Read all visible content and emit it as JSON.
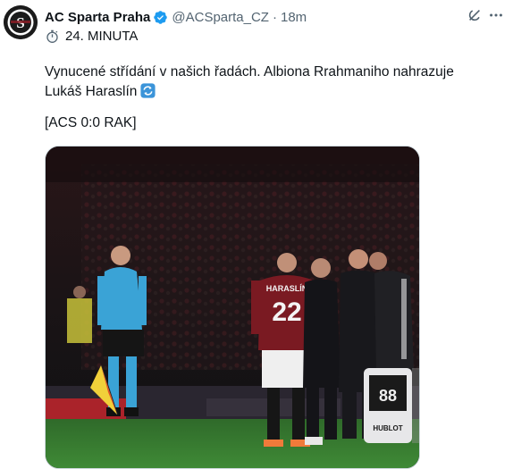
{
  "account": {
    "display_name": "AC Sparta Praha",
    "handle": "@ACSparta_CZ",
    "time_ago": "18m",
    "separator": "·"
  },
  "header_minute": "24. MINUTA",
  "tweet": {
    "text": "Vynucené střídání v našich řadách. Albiona Rrahmaniho nahrazuje Lukáš Haraslín",
    "score": "[ACS 0:0 RAK]"
  },
  "photo": {
    "jersey_name": "HARASLÍN",
    "jersey_number": "22",
    "board_brand": "HUBLOT"
  },
  "colors": {
    "verified": "#1d9bf0",
    "text": "#0f1419",
    "secondary": "#536471",
    "sparta_red": "#7a1a22"
  }
}
